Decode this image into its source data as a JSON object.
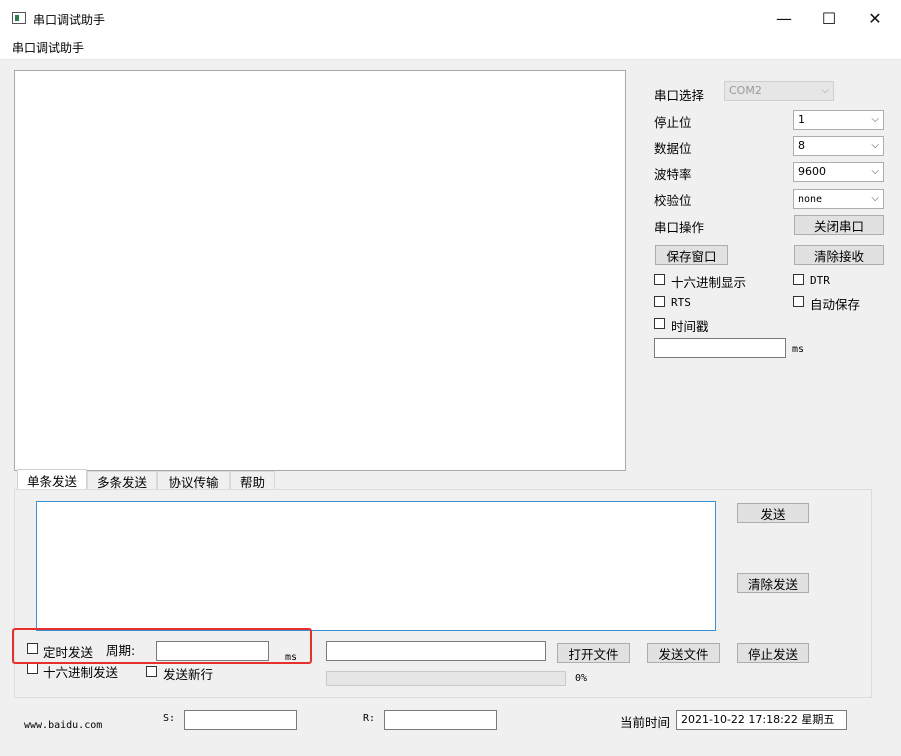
{
  "window": {
    "title": "串口调试助手",
    "minimize": "—",
    "maximize": "☐",
    "close": "✕"
  },
  "menu": {
    "items": [
      "串口调试助手"
    ]
  },
  "settings": {
    "port_label": "串口选择",
    "port_value": "COM2",
    "stopbits_label": "停止位",
    "stopbits_value": "1",
    "databits_label": "数据位",
    "databits_value": "8",
    "baud_label": "波特率",
    "baud_value": "9600",
    "parity_label": "校验位",
    "parity_value": "none",
    "operation_label": "串口操作",
    "close_port_button": "关闭串口",
    "save_window_button": "保存窗口",
    "clear_receive_button": "清除接收",
    "hex_display": "十六进制显示",
    "dtr": "DTR",
    "rts": "RTS",
    "auto_save": "自动保存",
    "timestamp": "时间戳",
    "interval_value": "",
    "interval_unit": "ms"
  },
  "tabs": [
    "单条发送",
    "多条发送",
    "协议传输",
    "帮助"
  ],
  "send": {
    "send_button": "发送",
    "clear_send_button": "清除发送",
    "timed_send": "定时发送",
    "period_label": "周期:",
    "period_value": "",
    "period_unit": "ms",
    "hex_send": "十六进制发送",
    "send_newline": "发送新行",
    "file_path_value": "",
    "open_file_button": "打开文件",
    "send_file_button": "发送文件",
    "stop_send_button": "停止发送",
    "progress_text": "0%",
    "progress_fraction": 0
  },
  "status": {
    "website": "www.baidu.com",
    "sent_label": "S:",
    "sent_value": "",
    "received_label": "R:",
    "received_value": "",
    "time_label": "当前时间",
    "time_value": "2021-10-22 17:18:22 星期五"
  },
  "colors": {
    "accent": "#3a8fd0",
    "highlight_box": "#e63030",
    "progress": "#06b025"
  },
  "icons": {
    "app": "serial-app-icon",
    "dropdown": "chevron-down-icon"
  }
}
